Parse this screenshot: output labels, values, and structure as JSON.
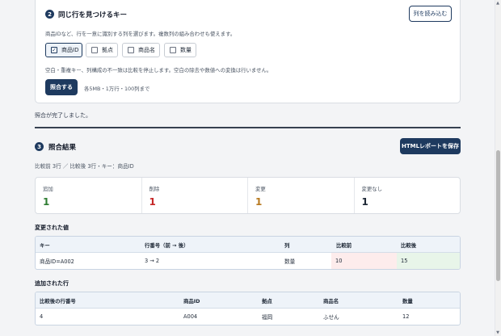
{
  "section2": {
    "step": "2",
    "title": "同じ行を見つけるキー",
    "read_columns_label": "列を読み込む",
    "description": "商品IDなど、行を一意に識別する列を選びます。複数列の組み合わせも使えます。",
    "key_options": [
      {
        "label": "商品ID",
        "checked": true
      },
      {
        "label": "拠点",
        "checked": false
      },
      {
        "label": "商品名",
        "checked": false
      },
      {
        "label": "数量",
        "checked": false
      }
    ],
    "note": "空白・重複キー、列構成の不一致は比較を停止します。空白の除去や数値への変換は行いません。",
    "compare_label": "照合する",
    "limit_note": "各5MB・1万行・100列まで"
  },
  "status_message": "照合が完了しました。",
  "section3": {
    "step": "3",
    "title": "照合結果",
    "save_label": "HTMLレポートを保存",
    "summary": "比較前 3行 ／ 比較後 3行・キー：商品ID"
  },
  "stats": [
    {
      "label": "追加",
      "value": "1",
      "color": "#2e7d32"
    },
    {
      "label": "削除",
      "value": "1",
      "color": "#c62828"
    },
    {
      "label": "変更",
      "value": "1",
      "color": "#b7791f"
    },
    {
      "label": "変更なし",
      "value": "1",
      "color": "#1f2937"
    }
  ],
  "changed": {
    "title": "変更された値",
    "headers": [
      "キー",
      "行番号（前 → 後）",
      "列",
      "比較前",
      "比較後"
    ],
    "rows": [
      [
        "商品ID=A002",
        "3 → 2",
        "数量",
        "10",
        "15"
      ]
    ]
  },
  "added": {
    "title": "追加された行",
    "headers": [
      "比較後の行番号",
      "商品ID",
      "拠点",
      "商品名",
      "数量"
    ],
    "rows": [
      [
        "4",
        "A004",
        "福岡",
        "ふせん",
        "12"
      ]
    ]
  }
}
